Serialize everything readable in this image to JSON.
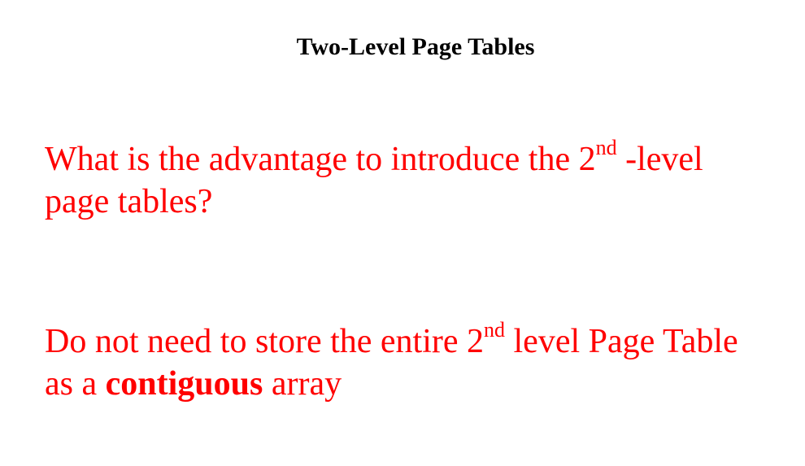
{
  "slide": {
    "title": "Two-Level Page Tables",
    "question": {
      "line1_a": "What is the advantage to introduce the 2",
      "line1_sup": "nd",
      "line1_b": " -level",
      "line2": "page tables?"
    },
    "answer": {
      "line1_a": "Do not need to store the entire 2",
      "line1_sup": "nd",
      "line1_b": " level Page Table",
      "line2_a": "as a ",
      "line2_bold": "contiguous",
      "line2_b": " array"
    }
  },
  "colors": {
    "title": "#000000",
    "body_text": "#ff0000",
    "background": "#ffffff"
  }
}
